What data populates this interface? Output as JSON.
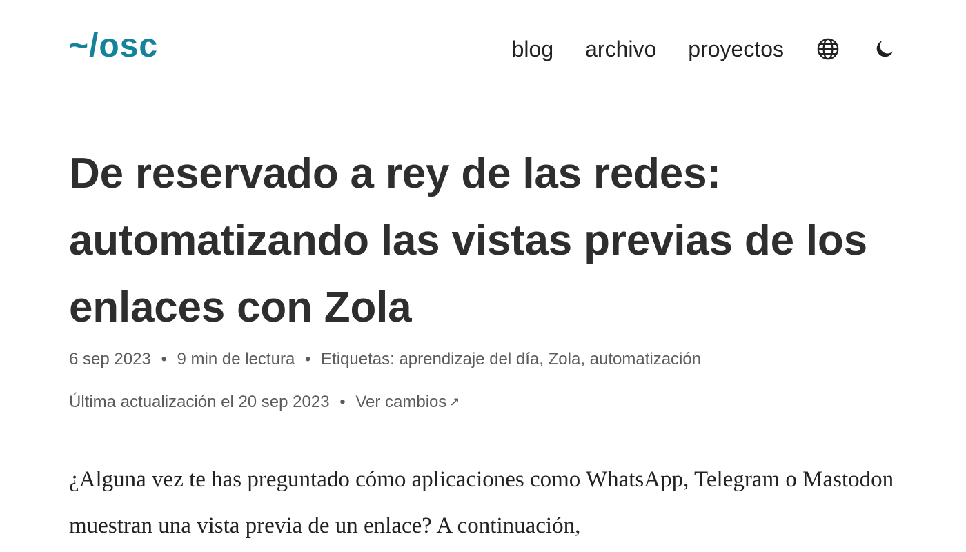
{
  "header": {
    "logo": "~/osc",
    "nav": {
      "blog": "blog",
      "archive": "archivo",
      "projects": "proyectos"
    },
    "icons": {
      "language": "globe-icon",
      "theme": "moon-icon"
    },
    "colors": {
      "logo": "#13829a",
      "text": "#2e2e2e",
      "meta": "#5c5c5c"
    }
  },
  "post": {
    "title": "De reservado a rey de las redes: automatizando las vistas previas de los enlaces con Zola",
    "date": "6 sep 2023",
    "separator": "•",
    "reading_time": "9 min de lectura",
    "tags_label": "Etiquetas: ",
    "tags": [
      "aprendizaje del día",
      "Zola",
      "automatización"
    ],
    "tag_separator": ", ",
    "updated": "Última actualización el 20 sep 2023",
    "changes_link": "Ver cambios",
    "changes_arrow": "↗",
    "intro": "¿Alguna vez te has preguntado cómo aplicaciones como WhatsApp, Telegram o Mastodon muestran una vista previa de un enlace? A continuación,"
  }
}
